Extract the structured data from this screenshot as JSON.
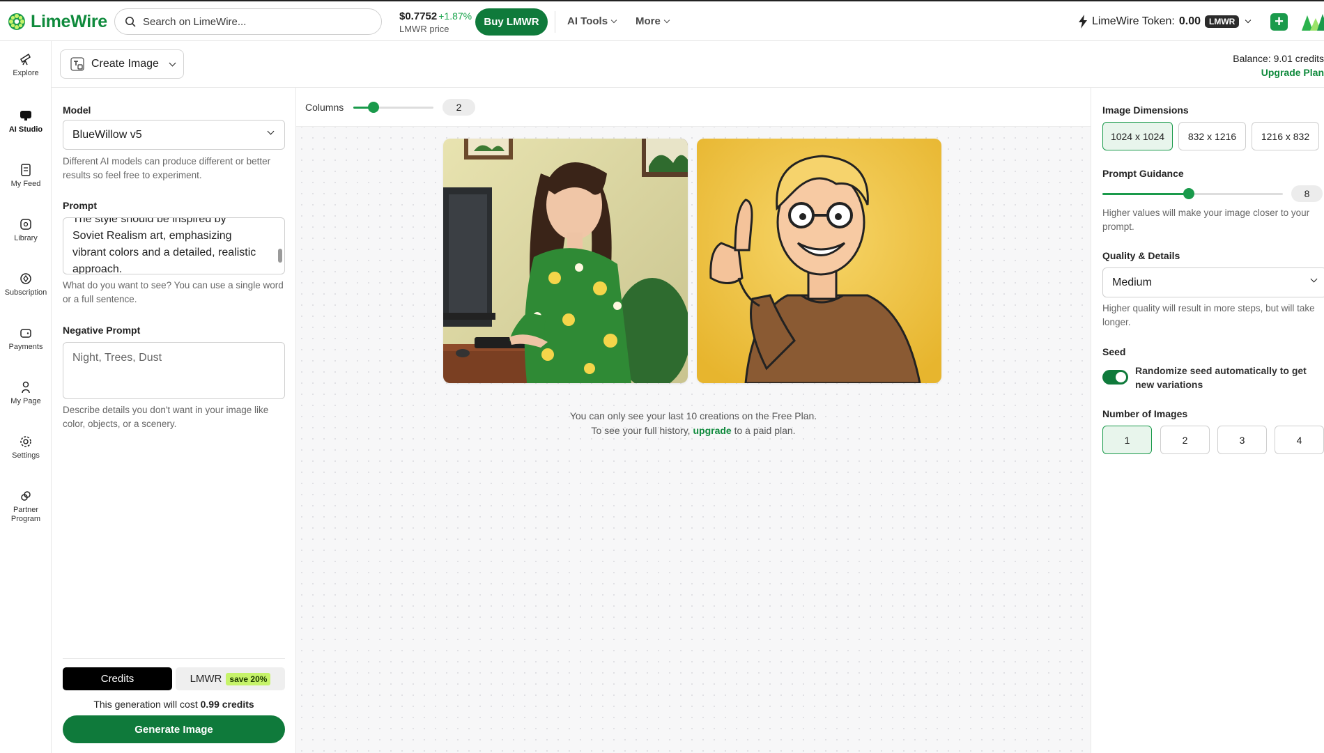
{
  "header": {
    "logo_text": "LimeWire",
    "search_placeholder": "Search on LimeWire...",
    "price_value": "$0.7752",
    "price_change": "+1.87%",
    "price_label": "LMWR price",
    "buy_label": "Buy LMWR",
    "nav": [
      {
        "label": "AI Tools"
      },
      {
        "label": "More"
      }
    ],
    "token_label": "LimeWire Token:",
    "token_value": "0.00",
    "token_unit": "LMWR"
  },
  "sidebar": {
    "items": [
      {
        "label": "Explore",
        "icon": "telescope-icon"
      },
      {
        "label": "AI Studio",
        "icon": "ai-studio-icon",
        "active": true
      },
      {
        "label": "My Feed",
        "icon": "feed-icon"
      },
      {
        "label": "Library",
        "icon": "library-icon"
      },
      {
        "label": "Subscription",
        "icon": "subscription-icon"
      },
      {
        "label": "Payments",
        "icon": "wallet-icon"
      },
      {
        "label": "My Page",
        "icon": "user-icon"
      },
      {
        "label": "Settings",
        "icon": "gear-icon"
      },
      {
        "label": "Partner Program",
        "icon": "partner-icon"
      }
    ]
  },
  "subheader": {
    "mode_label": "Create Image",
    "balance_text": "Balance: 9.01 credits",
    "upgrade_label": "Upgrade Plan"
  },
  "left_panel": {
    "model_label": "Model",
    "model_value": "BlueWillow v5",
    "model_help": "Different AI models can produce different or better results so feel free to experiment.",
    "prompt_label": "Prompt",
    "prompt_lines": [
      "The style should be inspired by",
      "Soviet Realism art, emphasizing",
      "vibrant colors and a detailed, realistic",
      "approach."
    ],
    "prompt_help": "What do you want to see? You can use a single word or a full sentence.",
    "negative_label": "Negative Prompt",
    "negative_placeholder": "Night, Trees, Dust",
    "negative_help": "Describe details you don't want in your image like color, objects, or a scenery.",
    "pay_credits": "Credits",
    "pay_lmwr": "LMWR",
    "save_badge": "save 20%",
    "cost_prefix": "This generation will cost",
    "cost_value": "0.99 credits",
    "generate_label": "Generate Image"
  },
  "center": {
    "columns_label": "Columns",
    "columns_value": "2",
    "columns_fraction": 0.25,
    "free_note_line1": "You can only see your last 10 creations on the Free Plan.",
    "free_note_prefix": "To see your full history,",
    "free_note_link": "upgrade",
    "free_note_suffix": "to a paid plan."
  },
  "right_panel": {
    "dimensions_label": "Image Dimensions",
    "dimensions": [
      "1024 x 1024",
      "832 x 1216",
      "1216 x 832"
    ],
    "dimensions_selected": 0,
    "guidance_label": "Prompt Guidance",
    "guidance_value": "8",
    "guidance_fraction": 0.48,
    "guidance_help": "Higher values will make your image closer to your prompt.",
    "quality_label": "Quality & Details",
    "quality_value": "Medium",
    "quality_help": "Higher quality will result in more steps, but will take longer.",
    "seed_label": "Seed",
    "seed_toggle_label": "Randomize seed automatically to get new variations",
    "seed_toggle_on": true,
    "num_images_label": "Number of Images",
    "num_images": [
      "1",
      "2",
      "3",
      "4"
    ],
    "num_images_selected": 0
  },
  "colors": {
    "brand_green": "#0f7a3b",
    "accent_green": "#1a9a4b",
    "link_green": "#0f8a3c"
  }
}
